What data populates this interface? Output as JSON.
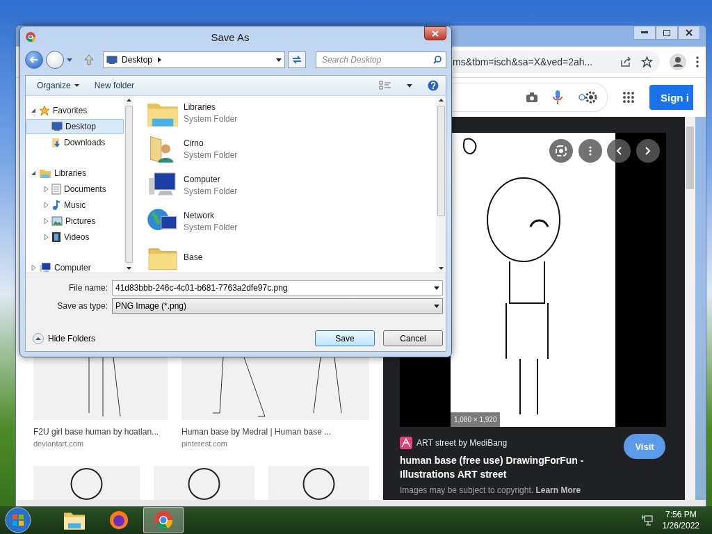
{
  "browser": {
    "url": "ms&tbm=isch&sa=X&ved=2ah...",
    "sign_in": "Sign i",
    "results": [
      {
        "title": "F2U girl base human by hoatlan...",
        "source": "deviantart.com"
      },
      {
        "title": "Human base by Medral | Human base ...",
        "source": "pinterest.com"
      }
    ],
    "preview": {
      "dimensions": "1,080 × 1,920",
      "site": "ART street by MediBang",
      "title": "human base (free use) DrawingForFun - Illustrations ART street",
      "visit": "Visit",
      "notice": "Images may be subject to copyright.",
      "notice_link": "Learn More"
    }
  },
  "dialog": {
    "title": "Save As",
    "address": "Desktop",
    "search": {
      "placeholder": "Search Desktop"
    },
    "commands": [
      "Organize",
      "New folder"
    ],
    "nav_tree": [
      {
        "label": "Favorites",
        "kind": "favorites",
        "expanded": true,
        "selected": false,
        "children": [
          {
            "label": "Desktop",
            "kind": "desktop",
            "selected": true
          },
          {
            "label": "Downloads",
            "kind": "downloads",
            "selected": false
          }
        ]
      },
      {
        "label": "Libraries",
        "kind": "libraries",
        "expanded": true,
        "selected": false,
        "children": [
          {
            "label": "Documents",
            "kind": "documents",
            "expanded": false,
            "selected": false
          },
          {
            "label": "Music",
            "kind": "music",
            "expanded": false,
            "selected": false
          },
          {
            "label": "Pictures",
            "kind": "pictures",
            "expanded": false,
            "selected": false
          },
          {
            "label": "Videos",
            "kind": "videos",
            "expanded": false,
            "selected": false
          }
        ]
      },
      {
        "label": "Computer",
        "kind": "computer",
        "expanded": false,
        "selected": false
      }
    ],
    "items": [
      {
        "name": "Libraries",
        "type": "System Folder",
        "kind": "libraries"
      },
      {
        "name": "Cirno",
        "type": "System Folder",
        "kind": "user"
      },
      {
        "name": "Computer",
        "type": "System Folder",
        "kind": "computer"
      },
      {
        "name": "Network",
        "type": "System Folder",
        "kind": "network"
      },
      {
        "name": "Base",
        "kind": "folder"
      }
    ],
    "file_name": {
      "label": "File name:",
      "value": "41d83bbb-246c-4c01-b681-7763a2dfe97c.png"
    },
    "file_type": {
      "label": "Save as type:",
      "value": "PNG Image (*.png)"
    },
    "hide_folders": "Hide Folders",
    "buttons": [
      "Save",
      "Cancel"
    ]
  },
  "taskbar": {
    "apps": [
      {
        "kind": "explorer",
        "selected": false
      },
      {
        "kind": "firefox",
        "selected": false
      },
      {
        "kind": "chrome",
        "selected": true
      }
    ],
    "clock": {
      "time": "7:56 PM",
      "date": "1/26/2022"
    }
  }
}
